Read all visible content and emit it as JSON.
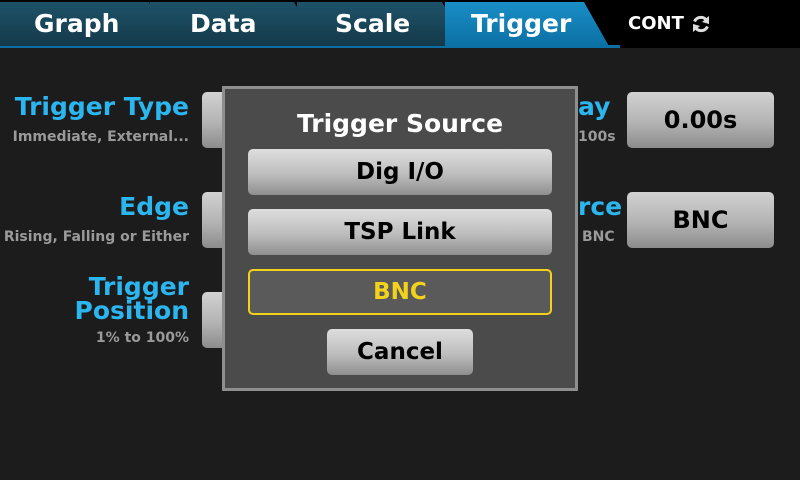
{
  "tabs": [
    {
      "label": "Graph",
      "active": false
    },
    {
      "label": "Data",
      "active": false
    },
    {
      "label": "Scale",
      "active": false
    },
    {
      "label": "Trigger",
      "active": true
    }
  ],
  "status": {
    "mode": "CONT",
    "icon": "refresh-icon"
  },
  "settings": {
    "trigger_type": {
      "label": "Trigger Type",
      "hint": "Immediate, External..."
    },
    "edge": {
      "label": "Edge",
      "hint": "Rising, Falling or Either"
    },
    "trigger_position": {
      "label_line1": "Trigger",
      "label_line2": "Position",
      "hint": "1% to 100%"
    },
    "delay": {
      "label_fragment": "ay",
      "hint_fragment": "100s",
      "value": "0.00s"
    },
    "source": {
      "label_fragment": "rce",
      "hint_fragment": "BNC",
      "value": "BNC"
    }
  },
  "dialog": {
    "title": "Trigger Source",
    "options": [
      {
        "label": "Dig I/O",
        "selected": false
      },
      {
        "label": "TSP Link",
        "selected": false
      },
      {
        "label": "BNC",
        "selected": true
      }
    ],
    "cancel_label": "Cancel"
  },
  "colors": {
    "accent_blue": "#2bb6f0",
    "active_tab": "#0b6fa3",
    "selection_yellow": "#f2d21b"
  }
}
